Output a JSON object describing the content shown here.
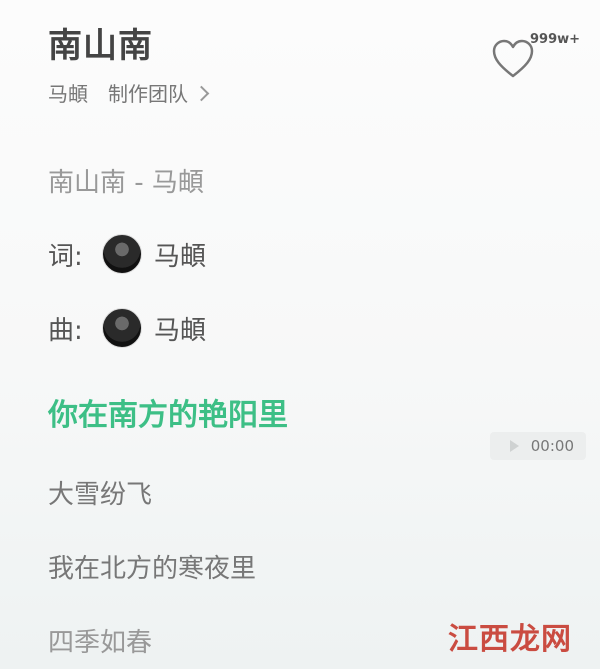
{
  "song": {
    "title": "南山南",
    "artist": "马頔",
    "team_link": "制作团队"
  },
  "like": {
    "icon": "heart-outline-icon",
    "count": "999w+"
  },
  "lyrics_header": "南山南 - 马頔",
  "credits": {
    "lyricist_label": "词:",
    "lyricist_name": "马頔",
    "composer_label": "曲:",
    "composer_name": "马頔"
  },
  "lyrics": {
    "active": "你在南方的艳阳里",
    "line1": "大雪纷飞",
    "line2": "我在北方的寒夜里",
    "line3": "四季如春"
  },
  "timestamp": "00:00",
  "colors": {
    "active_lyric": "#3dbf86"
  },
  "watermark": "江西龙网"
}
